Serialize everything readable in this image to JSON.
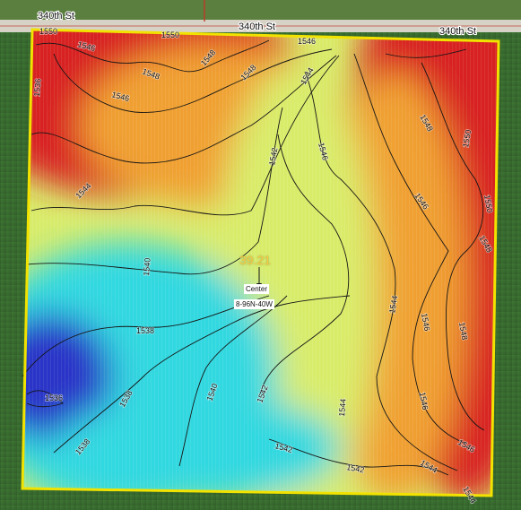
{
  "roads": [
    {
      "label": "340th St"
    },
    {
      "label": "340th St"
    },
    {
      "label": "340th St"
    }
  ],
  "field": {
    "acreage": "39.21",
    "center_label": "Center",
    "legal_description": "8-96N-40W",
    "boundary_color": "#f2e200"
  },
  "elevation_colors": {
    "low": "#2c34c8",
    "mid_low": "#30d8e0",
    "mid": "#d9ec6a",
    "mid_high": "#f0a030",
    "high": "#d82020"
  },
  "contour_labels": [
    {
      "text": "1550"
    },
    {
      "text": "1550"
    },
    {
      "text": "1546"
    },
    {
      "text": "1546"
    },
    {
      "text": "1548"
    },
    {
      "text": "1548"
    },
    {
      "text": "1548"
    },
    {
      "text": "1546"
    },
    {
      "text": "1544"
    },
    {
      "text": "1544"
    },
    {
      "text": "1542"
    },
    {
      "text": "1540"
    },
    {
      "text": "1538"
    },
    {
      "text": "1536"
    },
    {
      "text": "1538"
    },
    {
      "text": "1536"
    },
    {
      "text": "1538"
    },
    {
      "text": "1540"
    },
    {
      "text": "1542"
    },
    {
      "text": "1542"
    },
    {
      "text": "1542"
    },
    {
      "text": "1544"
    },
    {
      "text": "1544"
    },
    {
      "text": "1546"
    },
    {
      "text": "1544"
    },
    {
      "text": "1546"
    },
    {
      "text": "1546"
    },
    {
      "text": "1548"
    },
    {
      "text": "1546"
    },
    {
      "text": "1550"
    },
    {
      "text": "1550"
    },
    {
      "text": "1548"
    },
    {
      "text": "1548"
    },
    {
      "text": "1544"
    },
    {
      "text": "1546"
    }
  ]
}
